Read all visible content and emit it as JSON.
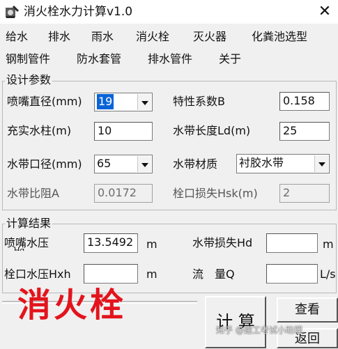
{
  "window": {
    "title": "消火栓水力计算v1.0",
    "close_glyph": "✕"
  },
  "menu": {
    "row1": [
      "给水",
      "排水",
      "雨水",
      "消火栓",
      "灭火器",
      "化粪池选型"
    ],
    "row2": [
      "钢制管件",
      "防水套管",
      "排水管件",
      "关于"
    ]
  },
  "design": {
    "caption": "设计参数",
    "nozzle_diameter": {
      "label": "喷嘴直径(mm)",
      "value": "19"
    },
    "coefficient_b": {
      "label": "特性系数B",
      "value": "0.158"
    },
    "water_column": {
      "label": "充实水柱(m)",
      "value": "10"
    },
    "hose_length": {
      "label": "水带长度Ld(m)",
      "value": "25"
    },
    "hose_diameter": {
      "label": "水带口径(mm)",
      "value": "65"
    },
    "hose_material": {
      "label": "水带材质",
      "value": "衬胶水带"
    },
    "hose_resistance": {
      "label": "水带比阻A",
      "value": "0.0172"
    },
    "hydrant_loss": {
      "label": "栓口损失Hsk(m)",
      "value": "2"
    }
  },
  "results": {
    "caption": "计算结果",
    "nozzle_pressure": {
      "label": "喷嘴水压",
      "label_overflow": "Hq",
      "value": "13.5492",
      "unit": "m"
    },
    "hose_loss": {
      "label": "水带损失Hd",
      "value": "",
      "unit": "m"
    },
    "hydrant_pressure": {
      "label": "栓口水压Hxh",
      "value": "",
      "unit": "m"
    },
    "flow": {
      "label": "流　量Q",
      "value": "",
      "unit": "L/s"
    }
  },
  "buttons": {
    "calculate": "计 算",
    "view": "查看",
    "back": "返回"
  },
  "banner_text": "消火栓",
  "watermark": "知乎 @建工考试小助理",
  "colors": {
    "banner": "#e3141c",
    "selection": "#0a64d8"
  }
}
